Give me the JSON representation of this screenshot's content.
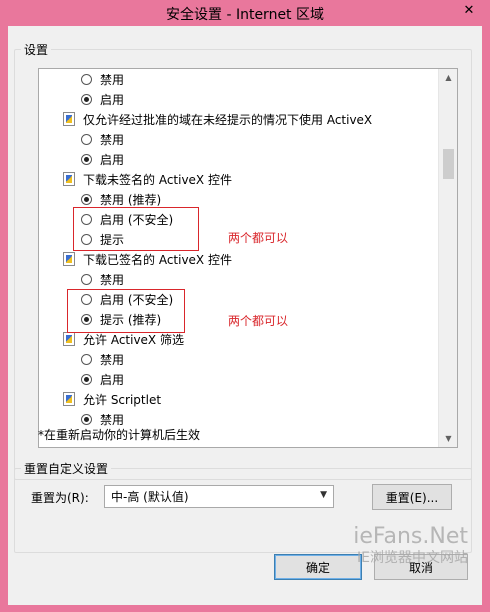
{
  "window": {
    "title": "安全设置 - Internet 区域",
    "close_glyph": "✕"
  },
  "settings_group": {
    "legend": "设置"
  },
  "list": [
    {
      "kind": "option",
      "label": "禁用",
      "checked": false
    },
    {
      "kind": "option",
      "label": "启用",
      "checked": true
    },
    {
      "kind": "setting",
      "label": "仅允许经过批准的域在未经提示的情况下使用 ActiveX"
    },
    {
      "kind": "option",
      "label": "禁用",
      "checked": false
    },
    {
      "kind": "option",
      "label": "启用",
      "checked": true
    },
    {
      "kind": "setting",
      "label": "下载未签名的 ActiveX 控件"
    },
    {
      "kind": "option",
      "label": "禁用 (推荐)",
      "checked": true
    },
    {
      "kind": "option",
      "label": "启用 (不安全)",
      "checked": false
    },
    {
      "kind": "option",
      "label": "提示",
      "checked": false
    },
    {
      "kind": "setting",
      "label": "下载已签名的 ActiveX 控件"
    },
    {
      "kind": "option",
      "label": "禁用",
      "checked": false
    },
    {
      "kind": "option",
      "label": "启用 (不安全)",
      "checked": false
    },
    {
      "kind": "option",
      "label": "提示 (推荐)",
      "checked": true
    },
    {
      "kind": "setting",
      "label": "允许 ActiveX 筛选"
    },
    {
      "kind": "option",
      "label": "禁用",
      "checked": false
    },
    {
      "kind": "option",
      "label": "启用",
      "checked": true
    },
    {
      "kind": "setting",
      "label": "允许 Scriptlet"
    },
    {
      "kind": "option",
      "label": "禁用",
      "checked": true
    }
  ],
  "annotations": [
    {
      "text": "两个都可以"
    },
    {
      "text": "两个都可以"
    }
  ],
  "note": "*在重新启动你的计算机后生效",
  "reset_group": {
    "legend": "重置自定义设置",
    "label": "重置为(R):",
    "selected": "中-高 (默认值)",
    "reset_button": "重置(E)..."
  },
  "buttons": {
    "ok": "确定",
    "cancel": "取消"
  },
  "watermark": {
    "brand": "ieFans.Net",
    "sub": "IE浏览器中文网站"
  }
}
